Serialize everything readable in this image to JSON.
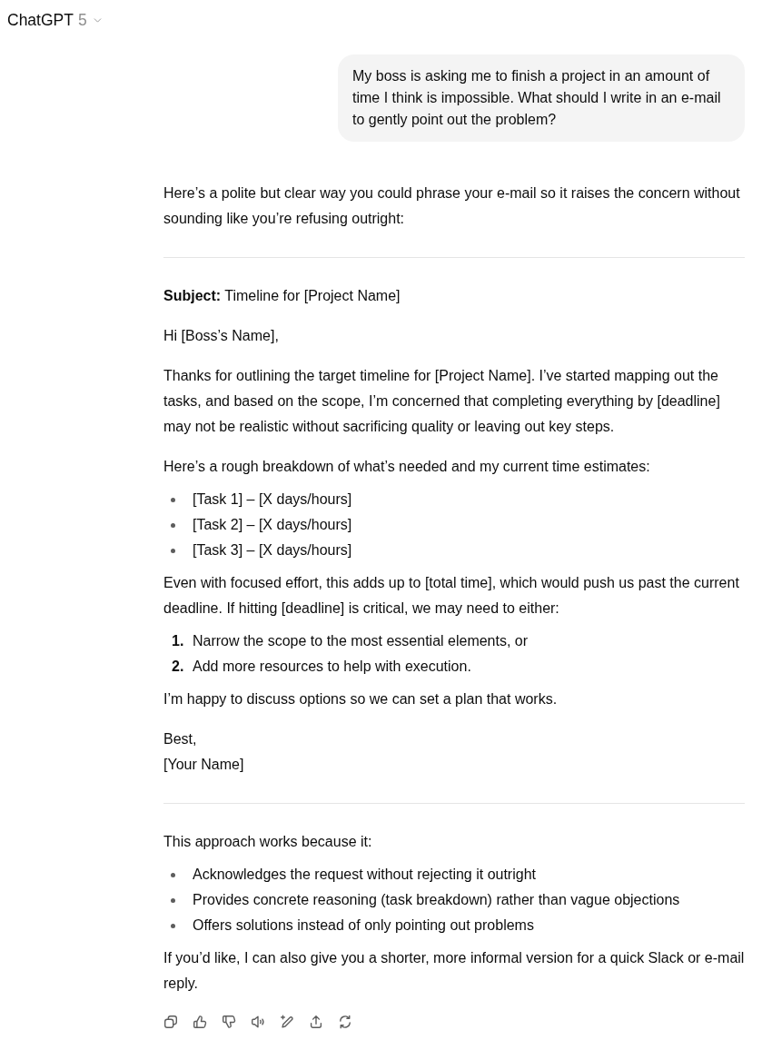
{
  "header": {
    "title": "ChatGPT",
    "version": "5"
  },
  "user_message": {
    "text": "My boss is asking me to finish a project in an amount of time I think is impossible. What should I write in an e-mail to gently point out the problem?"
  },
  "assistant_message": {
    "blocks": [
      {
        "kind": "paragraph",
        "text": "Here’s a polite but clear way you could phrase your e-mail so it raises the concern without sounding like you’re refusing outright:"
      },
      {
        "kind": "rule"
      },
      {
        "kind": "paragraph",
        "text": "**Subject:** Timeline for [Project Name]"
      },
      {
        "kind": "paragraph",
        "text": "Hi [Boss’s Name],"
      },
      {
        "kind": "paragraph",
        "text": "Thanks for outlining the target timeline for [Project Name]. I’ve started mapping out the tasks, and based on the scope, I’m concerned that completing everything by [deadline] may not be realistic without sacrificing quality or leaving out key steps."
      },
      {
        "kind": "paragraph",
        "text": "Here’s a rough breakdown of what’s needed and my current time estimates:"
      },
      {
        "kind": "bullets",
        "items": [
          "[Task 1] – [X days/hours]",
          "[Task 2] – [X days/hours]",
          "[Task 3] – [X days/hours]"
        ]
      },
      {
        "kind": "paragraph",
        "text": "Even with focused effort, this adds up to [total time], which would push us past the current deadline. If hitting [deadline] is critical, we may need to either:"
      },
      {
        "kind": "numbered",
        "items": [
          {
            "number": "1.",
            "text": "Narrow the scope to the most essential elements, or"
          },
          {
            "number": "2.",
            "text": "Add more resources to help with execution."
          }
        ]
      },
      {
        "kind": "paragraph",
        "text": "I’m happy to discuss options so we can set a plan that works."
      },
      {
        "kind": "lines",
        "lines": [
          "Best,",
          "[Your Name]"
        ]
      },
      {
        "kind": "rule"
      },
      {
        "kind": "paragraph",
        "text": "This approach works because it:"
      },
      {
        "kind": "bullets",
        "items": [
          "Acknowledges the request without rejecting it outright",
          "Provides concrete reasoning (task breakdown) rather than vague objections",
          "Offers solutions instead of only pointing out problems"
        ]
      },
      {
        "kind": "paragraph",
        "text": "If you’d like, I can also give you a shorter, more informal version for a quick Slack or e-mail reply."
      }
    ]
  }
}
